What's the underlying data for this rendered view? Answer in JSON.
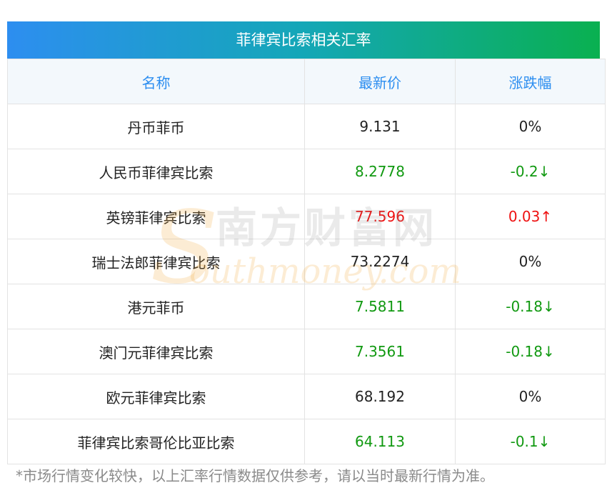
{
  "title": "菲律宾比索相关汇率",
  "headers": {
    "name": "名称",
    "price": "最新价",
    "change": "涨跌幅"
  },
  "rows": [
    {
      "name": "丹币菲币",
      "price": "9.131",
      "change": "0%",
      "trend": "flat"
    },
    {
      "name": "人民币菲律宾比索",
      "price": "8.2778",
      "change": "-0.2↓",
      "trend": "down"
    },
    {
      "name": "英镑菲律宾比索",
      "price": "77.596",
      "change": "0.03↑",
      "trend": "up"
    },
    {
      "name": "瑞士法郎菲律宾比索",
      "price": "73.2274",
      "change": "0%",
      "trend": "flat"
    },
    {
      "name": "港元菲币",
      "price": "7.5811",
      "change": "-0.18↓",
      "trend": "down"
    },
    {
      "name": "澳门元菲律宾比索",
      "price": "7.3561",
      "change": "-0.18↓",
      "trend": "down"
    },
    {
      "name": "欧元菲律宾比索",
      "price": "68.192",
      "change": "0%",
      "trend": "flat"
    },
    {
      "name": "菲律宾比索哥伦比亚比索",
      "price": "64.113",
      "change": "-0.1↓",
      "trend": "down"
    }
  ],
  "watermark": {
    "cn": "南方财富网",
    "en": "outhmoney.com",
    "initial": "S"
  },
  "note": "*市场行情变化较快，以上汇率行情数据仅供参考，请以当时最新行情为准。",
  "colors": {
    "up": "#ee1111",
    "down": "#119911",
    "flat": "#222222",
    "header_text": "#2d8ef0"
  }
}
